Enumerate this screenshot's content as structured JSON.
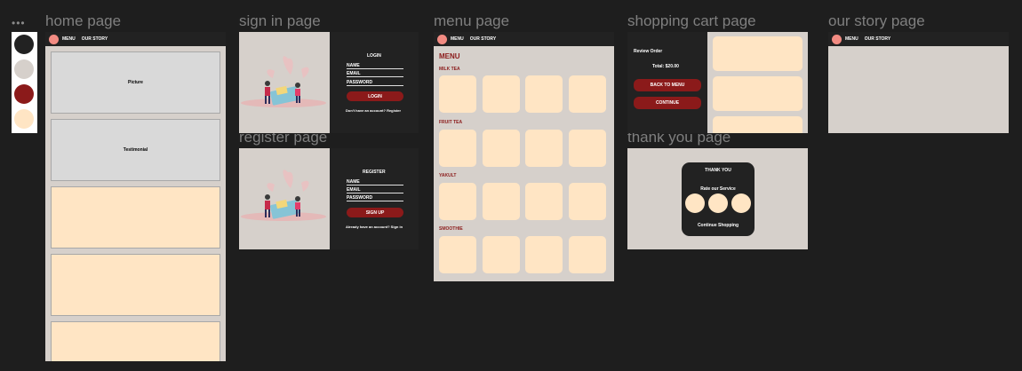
{
  "labels": {
    "home": "home page",
    "sign_in": "sign in page",
    "register": "register page",
    "menu": "menu page",
    "cart": "shopping cart page",
    "thank_you": "thank you page",
    "our_story": "our story page"
  },
  "palette_colors": [
    "#222222",
    "#d6d0cb",
    "#8b1a1a",
    "#ffe5c4"
  ],
  "nav": {
    "menu": "MENU",
    "our_story": "OUR STORY"
  },
  "home": {
    "picture": "Picture",
    "testimonial": "Testimonial"
  },
  "login": {
    "title": "LOGIN",
    "name": "NAME",
    "email": "EMAIL",
    "password": "PASSWORD",
    "button": "LOGIN",
    "footer": "Don't have an account? Register"
  },
  "register": {
    "title": "REGISTER",
    "name": "NAME",
    "email": "EMAIL",
    "password": "PASSWORD",
    "button": "SIGN UP",
    "footer": "Already have an account? Sign in"
  },
  "menu": {
    "title": "MENU",
    "sections": [
      "MILK TEA",
      "FRUIT TEA",
      "YAKULT",
      "SMOOTHIE"
    ]
  },
  "cart": {
    "review": "Review Order",
    "total": "Total: $20.00",
    "back_button": "BACK TO MENU",
    "continue_button": "CONTINUE"
  },
  "thank_you": {
    "title": "THANK YOU",
    "rate": "Rate our Service",
    "continue": "Continue Shopping"
  }
}
